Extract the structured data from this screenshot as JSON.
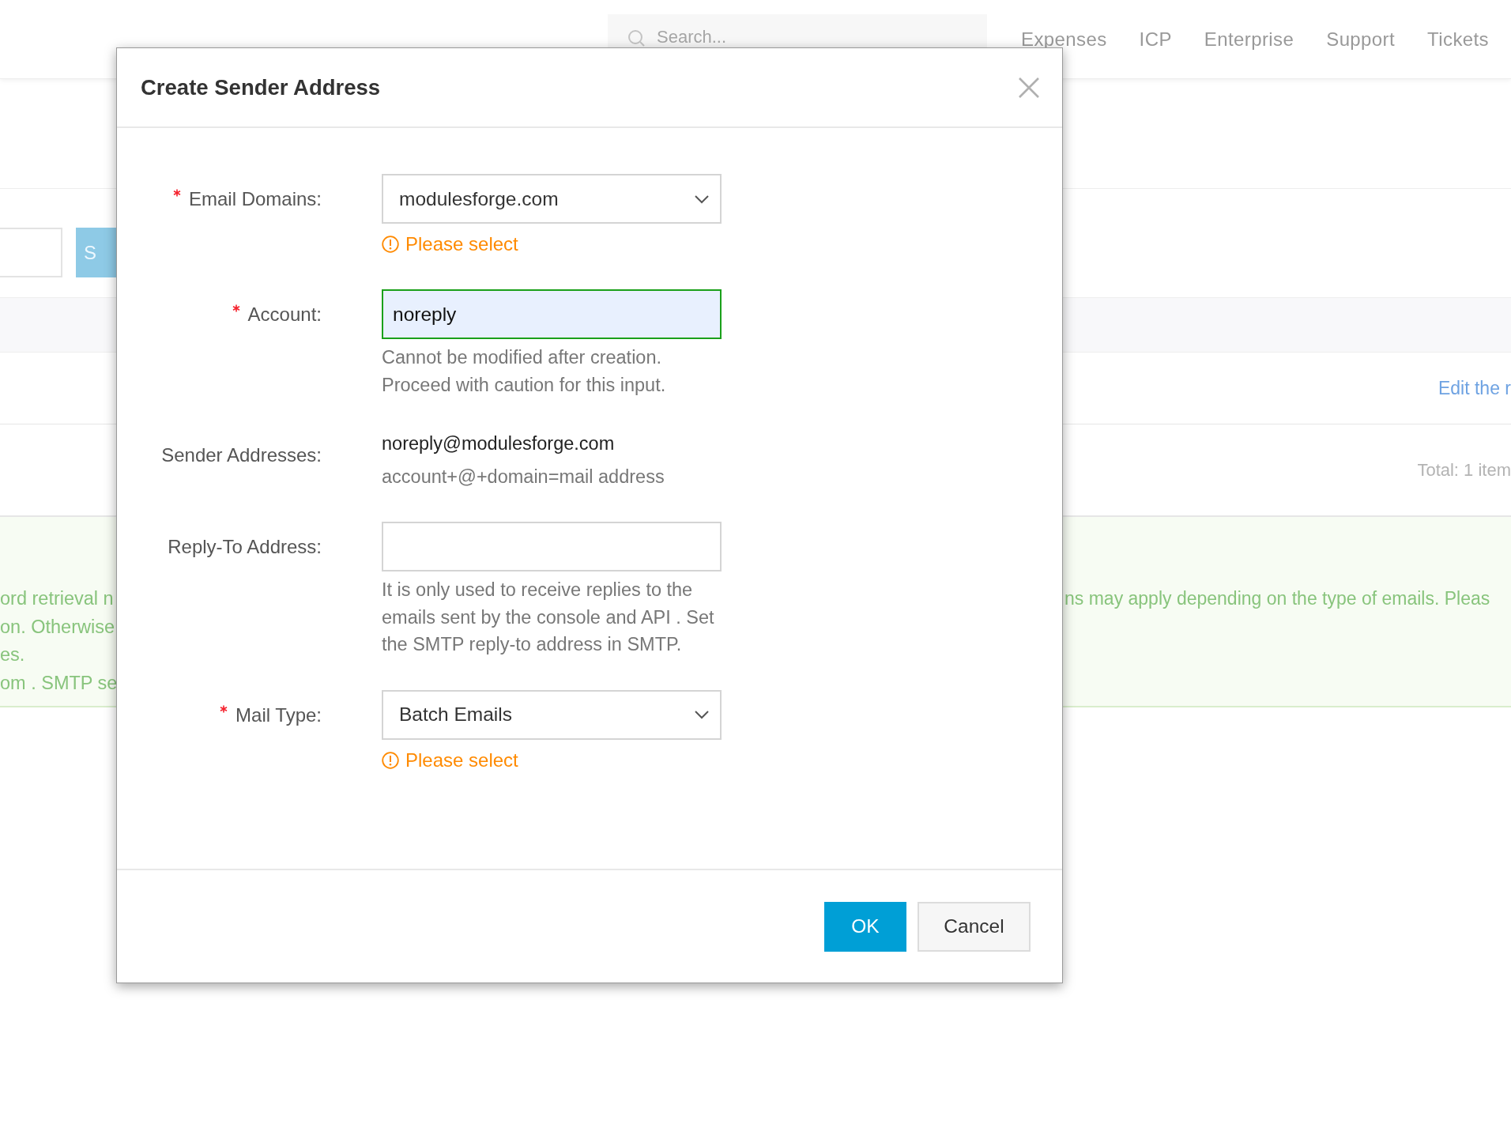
{
  "top_nav": {
    "search": {
      "placeholder": "Search..."
    },
    "items": [
      "Expenses",
      "ICP",
      "Enterprise",
      "Support",
      "Tickets"
    ]
  },
  "background": {
    "search_button": "S",
    "row_link": "Edit the r",
    "total": "Total: 1 item",
    "notice_left": [
      "ord retrieval n",
      "on. Otherwise",
      "es.",
      "om . SMTP se"
    ],
    "notice_right": "ns may apply depending on the type of emails. Pleas"
  },
  "dialog": {
    "title": "Create Sender Address",
    "fields": [
      {
        "kind": "select",
        "label": "Email Domains:",
        "required": true,
        "value": "modulesforge.com",
        "error": "Please select"
      },
      {
        "kind": "input",
        "label": "Account:",
        "required": true,
        "value": "noreply",
        "valid": true,
        "help": "Cannot be modified after creation. Proceed with caution for this input."
      },
      {
        "kind": "text",
        "label": "Sender Addresses:",
        "required": false,
        "value": "noreply@modulesforge.com",
        "hint": "account+@+domain=mail address"
      },
      {
        "kind": "input",
        "label": "Reply-To Address:",
        "required": false,
        "valid": false,
        "help": "It is only used to receive replies to the emails sent by the console and API . Set the SMTP reply-to address in SMTP."
      },
      {
        "kind": "select",
        "label": "Mail Type:",
        "required": true,
        "value": "Batch Emails",
        "error": "Please select"
      }
    ],
    "buttons": [
      {
        "label": "OK",
        "kind": "primary"
      },
      {
        "label": "Cancel",
        "kind": "secondary"
      }
    ]
  }
}
